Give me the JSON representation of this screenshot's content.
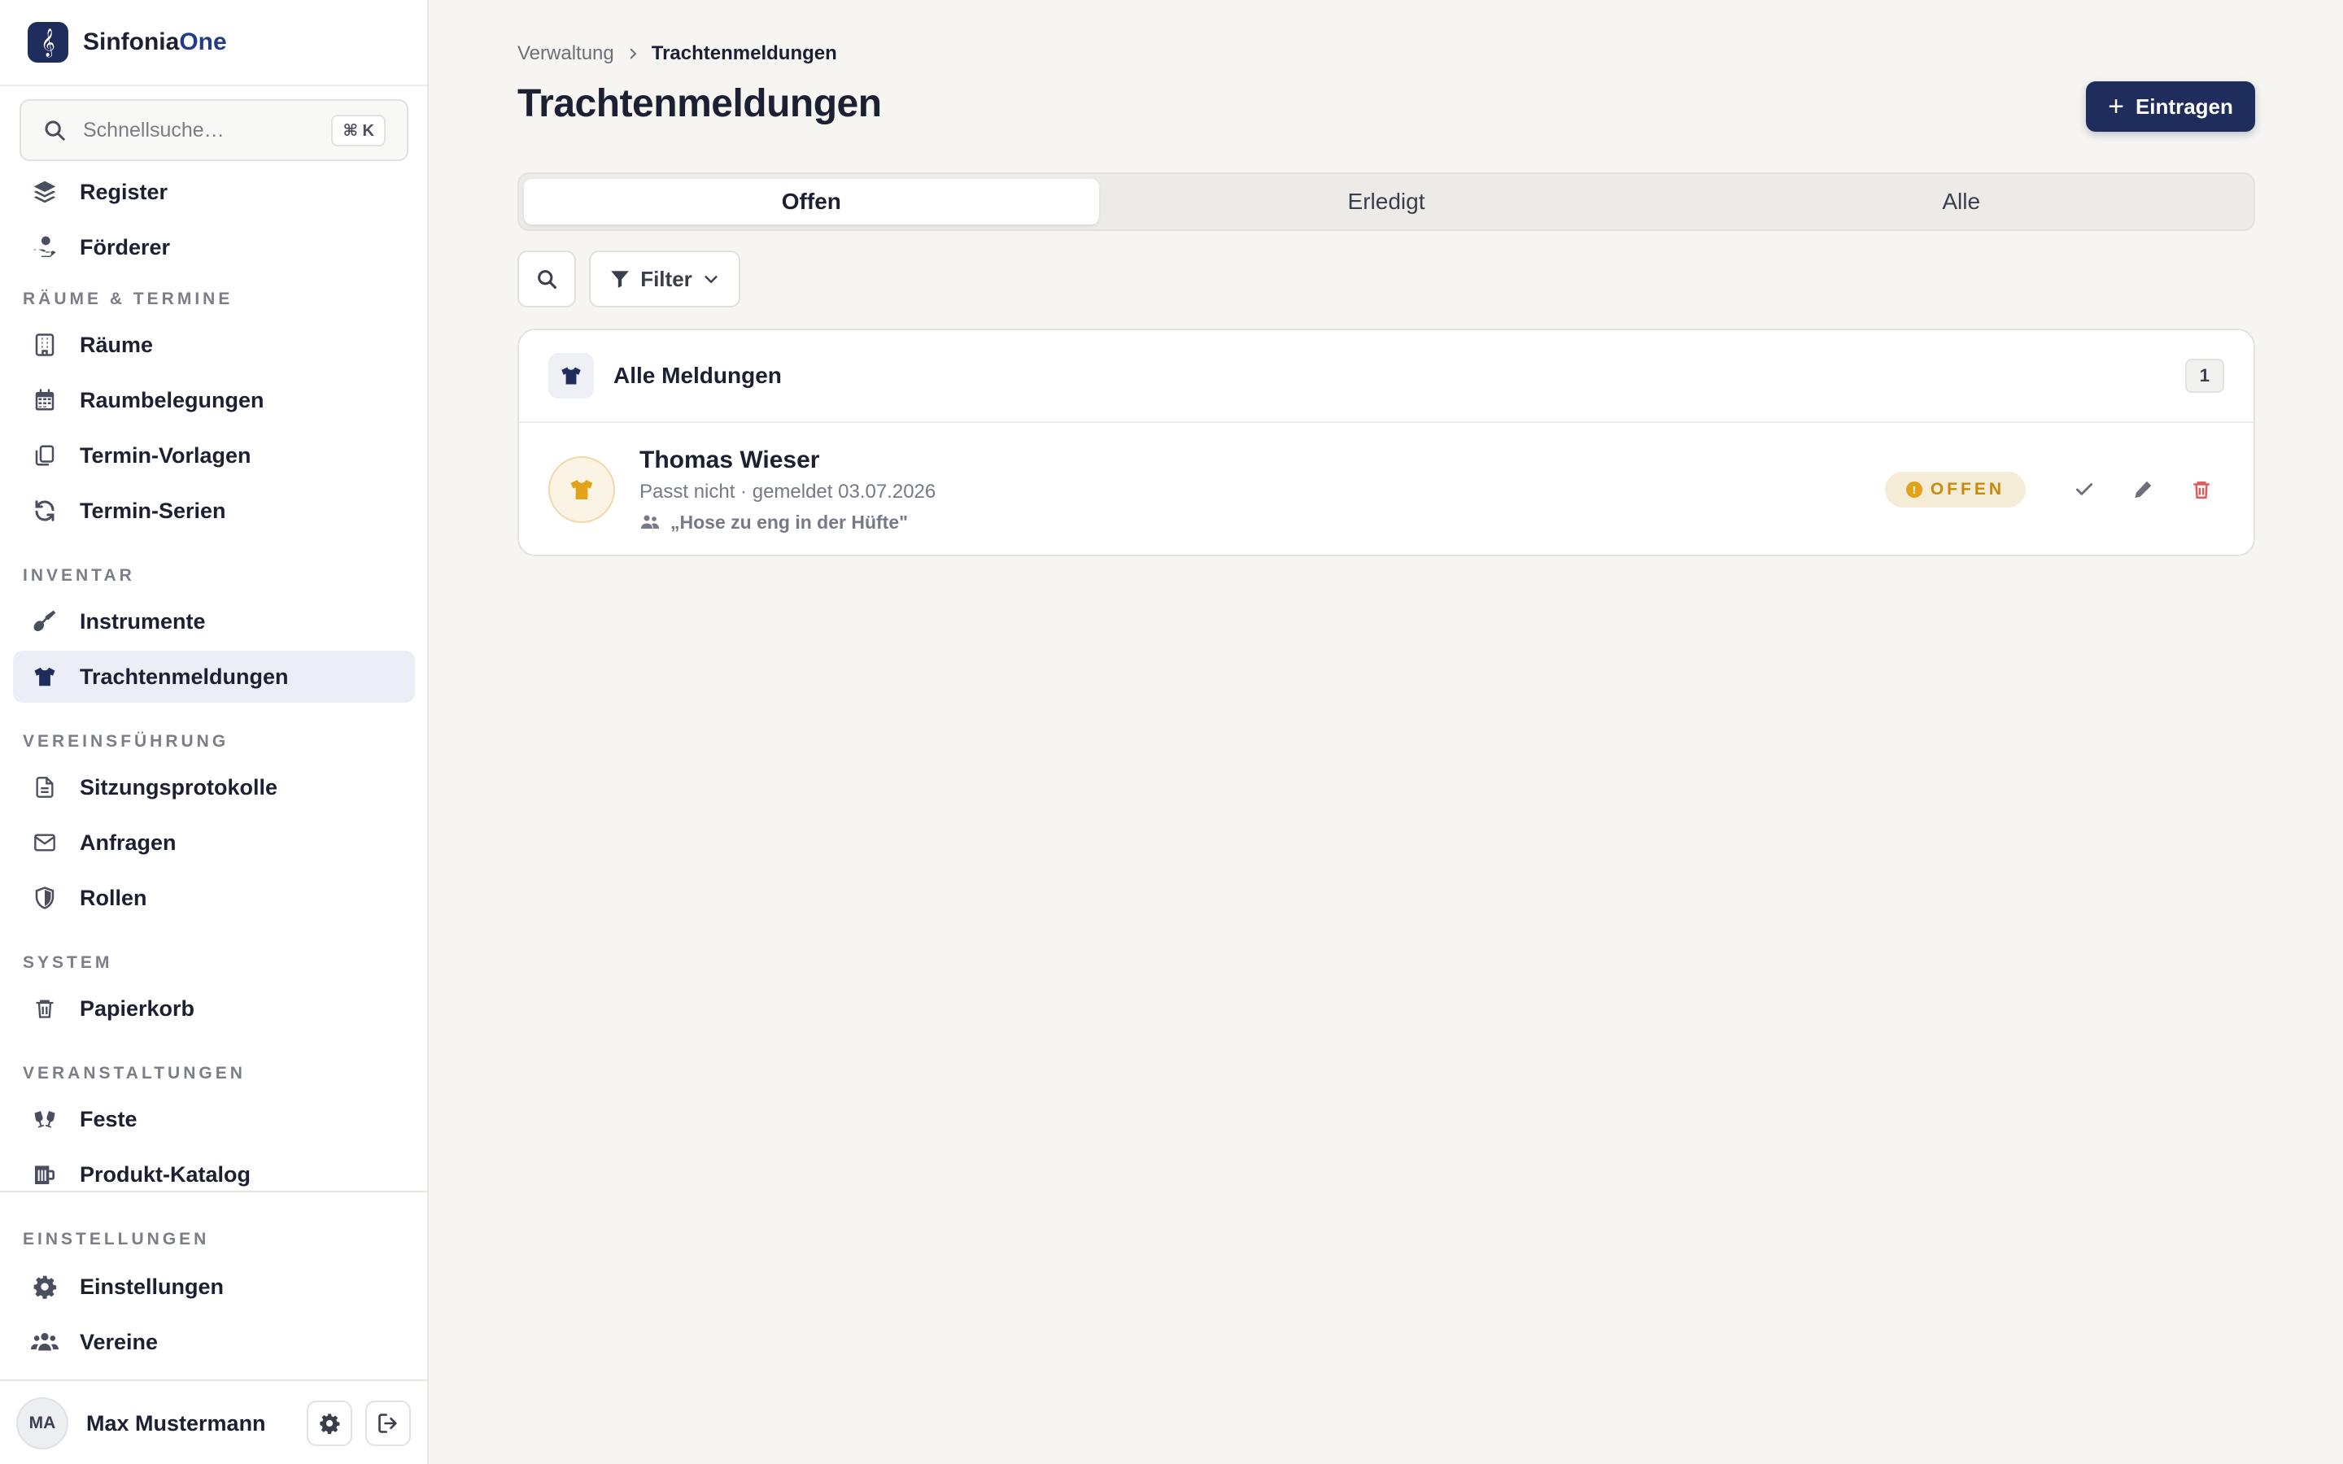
{
  "app": {
    "name_part1": "Sinfonia",
    "name_part2": "One",
    "logo_glyph": "𝄞"
  },
  "search": {
    "placeholder": "Schnellsuche…",
    "shortcut": "⌘ K"
  },
  "sidebar": {
    "top_items": [
      {
        "label": "Register",
        "icon": "layers-icon"
      },
      {
        "label": "Förderer",
        "icon": "hand-heart-icon"
      }
    ],
    "sections": [
      {
        "title": "RÄUME & TERMINE",
        "items": [
          {
            "label": "Räume",
            "icon": "building-icon"
          },
          {
            "label": "Raumbelegungen",
            "icon": "calendar-icon"
          },
          {
            "label": "Termin-Vorlagen",
            "icon": "copy-icon"
          },
          {
            "label": "Termin-Serien",
            "icon": "refresh-icon"
          }
        ]
      },
      {
        "title": "INVENTAR",
        "items": [
          {
            "label": "Instrumente",
            "icon": "guitar-icon"
          },
          {
            "label": "Trachtenmeldungen",
            "icon": "shirt-icon",
            "active": true
          }
        ]
      },
      {
        "title": "VEREINSFÜHRUNG",
        "items": [
          {
            "label": "Sitzungsprotokolle",
            "icon": "document-icon"
          },
          {
            "label": "Anfragen",
            "icon": "mail-icon"
          },
          {
            "label": "Rollen",
            "icon": "shield-icon"
          }
        ]
      },
      {
        "title": "SYSTEM",
        "items": [
          {
            "label": "Papierkorb",
            "icon": "trash-icon"
          }
        ]
      },
      {
        "title": "VERANSTALTUNGEN",
        "items": [
          {
            "label": "Feste",
            "icon": "cheers-icon"
          },
          {
            "label": "Produkt-Katalog",
            "icon": "beer-mug-icon"
          }
        ]
      }
    ],
    "settings_section": {
      "title": "EINSTELLUNGEN",
      "items": [
        {
          "label": "Einstellungen",
          "icon": "gear-icon"
        },
        {
          "label": "Vereine",
          "icon": "users-icon"
        }
      ]
    },
    "user": {
      "initials": "MA",
      "name": "Max Mustermann"
    }
  },
  "main": {
    "breadcrumb": {
      "root": "Verwaltung",
      "current": "Trachtenmeldungen"
    },
    "title": "Trachtenmeldungen",
    "primary_button": "Eintragen",
    "tabs": [
      {
        "label": "Offen",
        "active": true
      },
      {
        "label": "Erledigt"
      },
      {
        "label": "Alle"
      }
    ],
    "filter_label": "Filter",
    "card": {
      "title": "Alle Meldungen",
      "count": "1",
      "entries": [
        {
          "name": "Thomas Wieser",
          "meta": "Passt nicht · gemeldet 03.07.2026",
          "note": "„Hose zu eng in der Hüfte\"",
          "status": "OFFEN",
          "status_glyph": "!"
        }
      ]
    }
  },
  "colors": {
    "brand": "#1f2d5c",
    "accent_text": "#233c86",
    "status_open": "#e2a21a",
    "delete": "#e05a5a",
    "background": "#f6f5f2"
  }
}
